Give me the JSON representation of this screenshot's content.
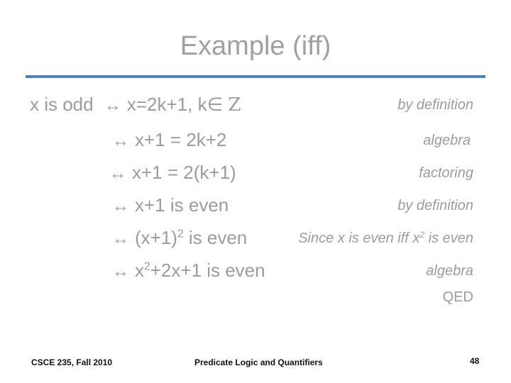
{
  "slide": {
    "title": "Example (iff)",
    "accent_color": "#4f81bd",
    "proof": {
      "first": {
        "lhs": "x is odd",
        "arrow": "↔",
        "rhs": "x=2k+1, k",
        "member_symbol": "∈",
        "set": "Z",
        "reason": "by definition"
      },
      "steps": [
        {
          "arrow": "↔",
          "text": "x+1 = 2k+2",
          "reason": "algebra"
        },
        {
          "arrow": "↔",
          "text": "x+1 = 2(k+1)",
          "reason": "factoring"
        },
        {
          "arrow": "↔",
          "text": "x+1 is even",
          "reason": "by definition"
        },
        {
          "arrow": "↔",
          "pre": "(x+1)",
          "sup": "2",
          "post": " is even",
          "reason_pre": "Since x is even iff x",
          "reason_sup": "2",
          "reason_post": " is even"
        },
        {
          "arrow": "↔",
          "pre": "x",
          "sup": "2",
          "post": "+2x+1 is even",
          "reason": "algebra"
        }
      ],
      "conclusion": "QED"
    },
    "footer": {
      "course": "CSCE 235, Fall 2010",
      "topic": "Predicate Logic and Quantifiers",
      "page_number": "48"
    }
  }
}
